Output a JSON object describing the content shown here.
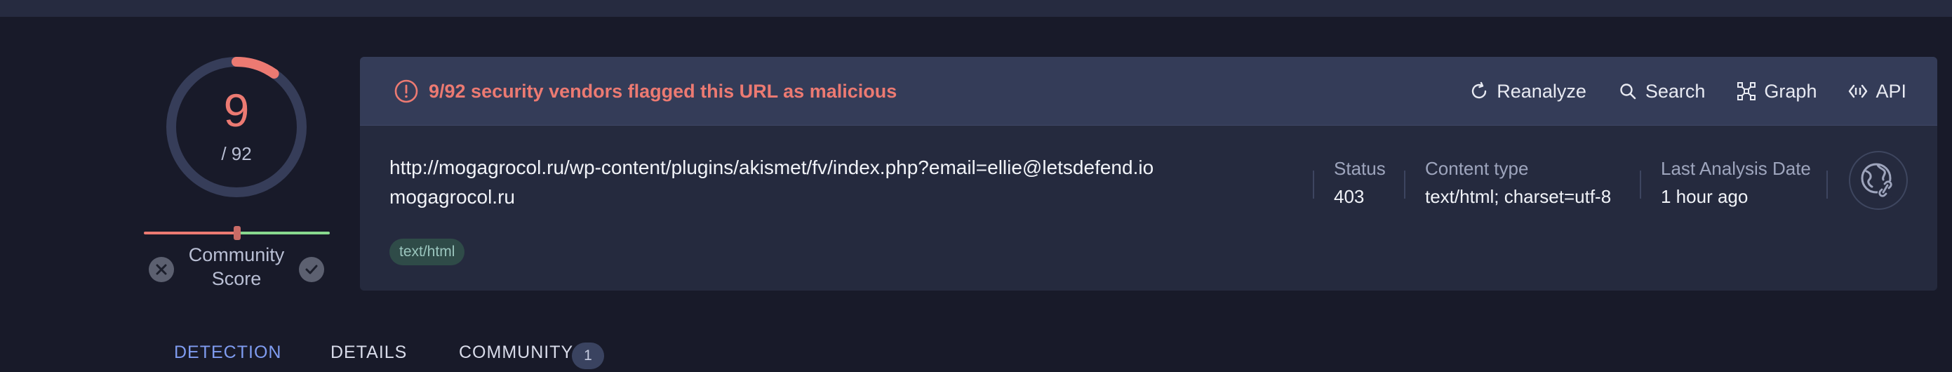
{
  "score": {
    "detections": "9",
    "total": "/ 92",
    "detection_fraction": 0.0978,
    "ring_color": "#ec7a72",
    "track_color": "#363d59"
  },
  "community": {
    "label": "Community Score",
    "label_line1": "Community",
    "label_line2": "Score",
    "negative_color": "#ec7a72",
    "positive_color": "#88d98e"
  },
  "alert": {
    "icon": "exclamation-circle-icon",
    "text": "9/92 security vendors flagged this URL as malicious",
    "color": "#ec7a72"
  },
  "actions": [
    {
      "label": "Reanalyze",
      "icon": "refresh-icon"
    },
    {
      "label": "Search",
      "icon": "search-icon"
    },
    {
      "label": "Graph",
      "icon": "graph-icon"
    },
    {
      "label": "API",
      "icon": "api-icon"
    }
  ],
  "target": {
    "url": "http://mogagrocol.ru/wp-content/plugins/akismet/fv/index.php?email=ellie@letsdefend.io",
    "domain": "mogagrocol.ru",
    "tag": "text/html"
  },
  "meta": {
    "status_label": "Status",
    "status_value": "403",
    "content_type_label": "Content type",
    "content_type_value": "text/html; charset=utf-8",
    "last_analysis_label": "Last Analysis Date",
    "last_analysis_value": "1 hour ago"
  },
  "tabs": [
    {
      "label": "DETECTION",
      "active": true
    },
    {
      "label": "DETAILS",
      "active": false
    },
    {
      "label": "COMMUNITY",
      "active": false,
      "badge": "1"
    }
  ]
}
